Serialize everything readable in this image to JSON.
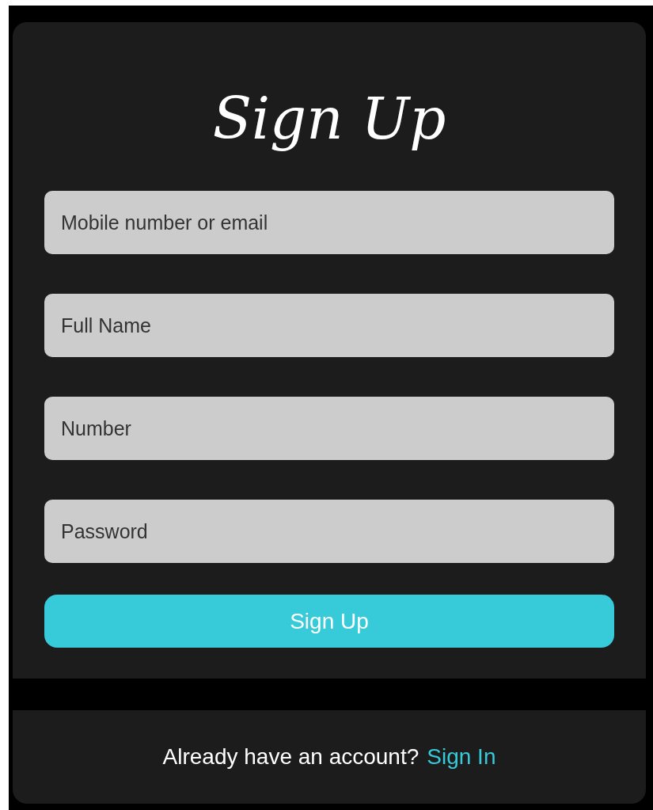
{
  "title": "Sign Up",
  "fields": [
    {
      "placeholder": "Mobile number or email"
    },
    {
      "placeholder": "Full Name"
    },
    {
      "placeholder": "Number"
    },
    {
      "placeholder": "Password"
    }
  ],
  "submit_button": "Sign Up",
  "footer": {
    "prompt": "Already have an account?",
    "link": "Sign In"
  }
}
